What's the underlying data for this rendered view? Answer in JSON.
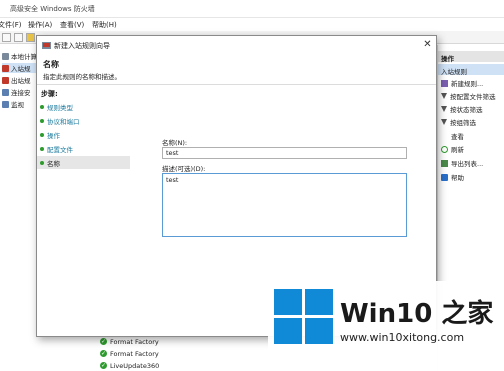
{
  "main_window": {
    "title": "高级安全 Windows 防火墙",
    "menu": [
      "文件(F)",
      "操作(A)",
      "查看(V)",
      "帮助(H)"
    ],
    "tree": [
      {
        "label": "本地计算",
        "icon": "computer-icon"
      },
      {
        "label": "入站规",
        "icon": "inbound-rules-icon"
      },
      {
        "label": "出站规",
        "icon": "outbound-rules-icon"
      },
      {
        "label": "连接安",
        "icon": "connection-security-icon"
      },
      {
        "label": "监视",
        "icon": "monitor-icon"
      }
    ],
    "rules": [
      "Format Factory",
      "Format Factory",
      "LiveUpdate360"
    ]
  },
  "actions": {
    "header": "操作",
    "section": "入站规则",
    "items": [
      {
        "label": "新建规则...",
        "icon": "new-rule-icon"
      },
      {
        "label": "按配置文件筛选",
        "icon": "filter-icon"
      },
      {
        "label": "按状态筛选",
        "icon": "filter-icon"
      },
      {
        "label": "按组筛选",
        "icon": "filter-icon"
      },
      {
        "label": "查看",
        "icon": "view-icon"
      },
      {
        "label": "刷新",
        "icon": "refresh-icon"
      },
      {
        "label": "导出列表...",
        "icon": "export-icon"
      },
      {
        "label": "帮助",
        "icon": "help-icon"
      }
    ]
  },
  "wizard": {
    "title": "新建入站规则向导",
    "heading": "名称",
    "description": "指定此规则的名称和描述。",
    "steps_label": "步骤:",
    "steps": [
      "规则类型",
      "协议和端口",
      "操作",
      "配置文件",
      "名称"
    ],
    "active_step": 4,
    "name_label": "名称(N):",
    "name_value": "test",
    "desc_label": "描述(可选)(D):",
    "desc_value": "test",
    "close_symbol": "✕"
  },
  "watermark": {
    "title": "Win10 之家",
    "url": "www.win10xitong.com",
    "brand_color": "#1089d6"
  }
}
